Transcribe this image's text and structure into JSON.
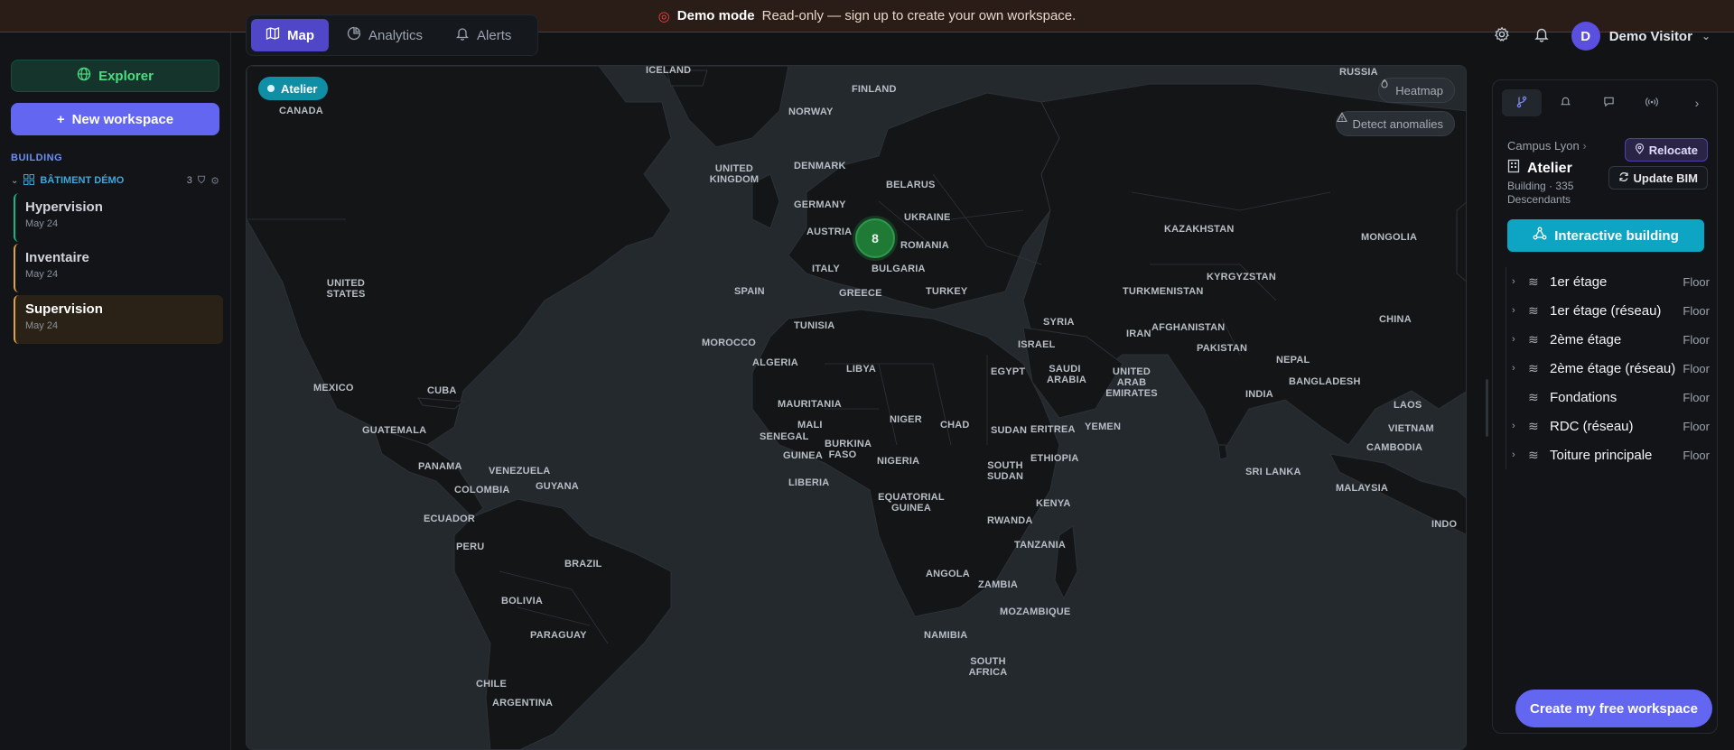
{
  "banner": {
    "icon": "dart-icon",
    "title": "Demo mode",
    "message": "Read-only — sign up to create your own workspace."
  },
  "nav": {
    "tabs": [
      {
        "label": "Map",
        "icon": "map-icon",
        "active": true
      },
      {
        "label": "Analytics",
        "icon": "pie-chart-icon",
        "active": false
      },
      {
        "label": "Alerts",
        "icon": "bell-icon",
        "active": false
      }
    ]
  },
  "user": {
    "initial": "D",
    "name": "Demo Visitor"
  },
  "sidebar": {
    "explorer_label": "Explorer",
    "new_workspace_label": "New workspace",
    "section_label": "BUILDING",
    "group": {
      "name": "BÂTIMENT DÉMO",
      "count": "3"
    },
    "workspaces": [
      {
        "name": "Hypervision",
        "date": "May 24"
      },
      {
        "name": "Inventaire",
        "date": "May 24"
      },
      {
        "name": "Supervision",
        "date": "May 24"
      }
    ]
  },
  "map": {
    "chip_label": "Atelier",
    "heatmap_label": "Heatmap",
    "anomalies_label": "Detect anomalies",
    "cluster_count": "8",
    "countries": [
      "ICELAND",
      "RUSSIA",
      "FINLAND",
      "CANADA",
      "NORWAY",
      "UNITED KINGDOM",
      "DENMARK",
      "BELARUS",
      "GERMANY",
      "UKRAINE",
      "AUSTRIA",
      "ROMANIA",
      "KAZAKHSTAN",
      "MONGOLIA",
      "ITALY",
      "BULGARIA",
      "KYRGYZSTAN",
      "UNITED STATES",
      "SPAIN",
      "GREECE",
      "TURKEY",
      "TURKMENISTAN",
      "SYRIA",
      "TUNISIA",
      "AFGHANISTAN",
      "CHINA",
      "MOROCCO",
      "IRAN",
      "ISRAEL",
      "PAKISTAN",
      "ALGERIA",
      "LIBYA",
      "EGYPT",
      "SAUDI ARABIA",
      "UNITED ARAB EMIRATES",
      "NEPAL",
      "BANGLADESH",
      "MEXICO",
      "CUBA",
      "INDIA",
      "MAURITANIA",
      "NIGER",
      "LAOS",
      "MALI",
      "CHAD",
      "SUDAN",
      "ERITREA",
      "YEMEN",
      "GUATEMALA",
      "VIETNAM",
      "SENEGAL",
      "BURKINA FASO",
      "CAMBODIA",
      "GUINEA",
      "NIGERIA",
      "SOUTH SUDAN",
      "ETHIOPIA",
      "PANAMA",
      "VENEZUELA",
      "SRI LANKA",
      "LIBERIA",
      "GUYANA",
      "COLOMBIA",
      "MALAYSIA",
      "EQUATORIAL GUINEA",
      "KENYA",
      "ECUADOR",
      "RWANDA",
      "INDO",
      "PERU",
      "TANZANIA",
      "BRAZIL",
      "ANGOLA",
      "ZAMBIA",
      "BOLIVIA",
      "MOZAMBIQUE",
      "PARAGUAY",
      "NAMIBIA",
      "SOUTH AFRICA",
      "CHILE",
      "ARGENTINA"
    ]
  },
  "panel": {
    "tabs": [
      "git-branch-icon",
      "bell-icon",
      "comment-icon",
      "signal-icon",
      "chevron-right-icon"
    ],
    "breadcrumb": "Campus Lyon",
    "title": "Atelier",
    "meta": "Building · 335 Descendants",
    "relocate_label": "Relocate",
    "update_bim_label": "Update BIM",
    "interactive_label": "Interactive building",
    "floors": [
      {
        "name": "1er étage",
        "type": "Floor",
        "expandable": true
      },
      {
        "name": "1er étage (réseau)",
        "type": "Floor",
        "expandable": true
      },
      {
        "name": "2ème étage",
        "type": "Floor",
        "expandable": true
      },
      {
        "name": "2ème étage (réseau)",
        "type": "Floor",
        "expandable": true
      },
      {
        "name": "Fondations",
        "type": "Floor",
        "expandable": false
      },
      {
        "name": "RDC (réseau)",
        "type": "Floor",
        "expandable": true
      },
      {
        "name": "Toiture principale",
        "type": "Floor",
        "expandable": true
      }
    ]
  },
  "cta_label": "Create my free workspace"
}
